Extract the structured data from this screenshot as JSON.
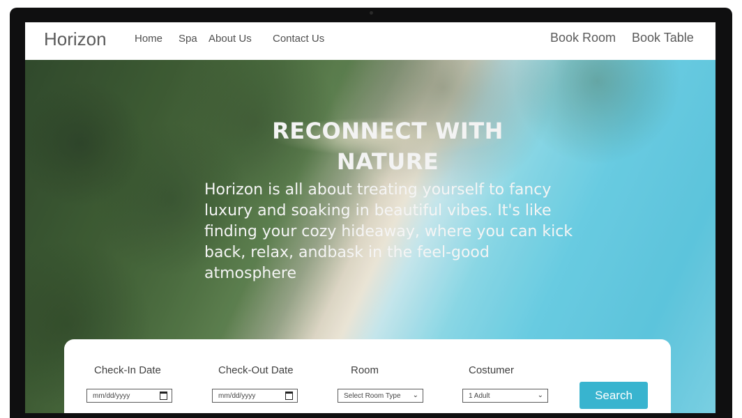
{
  "nav": {
    "logo": "Horizon",
    "links": [
      "Home",
      "Spa",
      "About Us",
      "Contact Us"
    ],
    "right_links": [
      "Book Room",
      "Book Table"
    ]
  },
  "hero": {
    "title": "RECONNECT WITH NATURE",
    "description": "Horizon is all about treating yourself to fancy luxury and soaking in beautiful vibes. It's like finding your cozy hideaway, where you can kick back, relax, andbask in the feel-good  atmosphere"
  },
  "booking": {
    "checkin_label": "Check-In Date",
    "checkin_value": "mm/dd/yyyy",
    "checkout_label": "Check-Out Date",
    "checkout_value": "mm/dd/yyyy",
    "room_label": "Room",
    "room_value": "Select Room Type",
    "customer_label": "Costumer",
    "customer_value": "1 Adult",
    "search_label": "Search"
  },
  "colors": {
    "accent": "#38b4cf",
    "text": "#4f4f4f"
  },
  "icons": {
    "date": "calendar-icon",
    "dropdown": "chevron-down-icon"
  }
}
